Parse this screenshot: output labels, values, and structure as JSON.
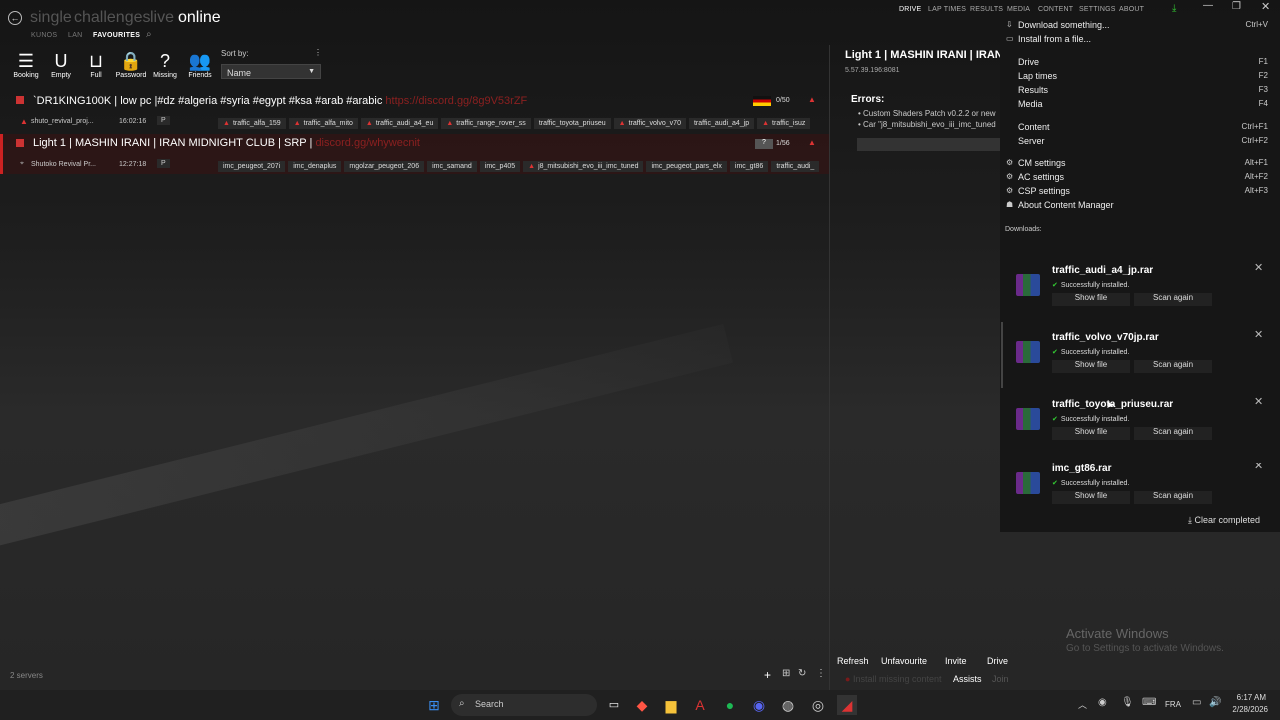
{
  "header": {
    "modes": [
      "single",
      "challenges",
      "live",
      "online"
    ],
    "submodes": [
      "KUNOS",
      "LAN",
      "FAVOURITES"
    ],
    "nav": [
      "DRIVE",
      "LAP TIMES",
      "RESULTS",
      "MEDIA",
      "CONTENT",
      "SETTINGS",
      "ABOUT"
    ]
  },
  "filters": [
    {
      "icon": "☰",
      "label": "Booking"
    },
    {
      "icon": "U",
      "label": "Empty"
    },
    {
      "icon": "⊔",
      "label": "Full"
    },
    {
      "icon": "🔒",
      "label": "Password"
    },
    {
      "icon": "?",
      "label": "Missing"
    },
    {
      "icon": "👥",
      "label": "Friends"
    }
  ],
  "sort": {
    "label": "Sort by:",
    "value": "Name"
  },
  "servers": [
    {
      "name": "`DR1KING100K | low pc |#dz #algeria #syria #egypt #ksa #arab #arabic",
      "link": "https://discord.gg/8g9V53rZF",
      "track": "shuto_revival_proj...",
      "time": "16:02:16",
      "badge": "P",
      "players": "0/50",
      "cars": [
        {
          "name": "traffic_alfa_159",
          "warn": true
        },
        {
          "name": "traffic_alfa_mito",
          "warn": true
        },
        {
          "name": "traffic_audi_a4_eu",
          "warn": true
        },
        {
          "name": "traffic_range_rover_ss",
          "warn": true
        },
        {
          "name": "traffic_toyota_priuseu",
          "warn": false
        },
        {
          "name": "traffic_volvo_v70",
          "warn": true
        },
        {
          "name": "traffic_audi_a4_jp",
          "warn": false
        },
        {
          "name": "traffic_isuz",
          "warn": true
        }
      ]
    },
    {
      "name": "Light 1 | MASHIN IRANI | IRAN MIDNIGHT CLUB | SRP |",
      "link": "discord.gg/whywecnit",
      "track": "Shutoko Revival Pr...",
      "time": "12:27:18",
      "badge": "P",
      "players": "1/56",
      "cars": [
        {
          "name": "imc_peugeot_207i",
          "warn": false
        },
        {
          "name": "imc_denaplus",
          "warn": false
        },
        {
          "name": "mgolzar_peugeot_206",
          "warn": false
        },
        {
          "name": "imc_samand",
          "warn": false
        },
        {
          "name": "imc_p405",
          "warn": false
        },
        {
          "name": "j8_mitsubishi_evo_iii_imc_tuned",
          "warn": true
        },
        {
          "name": "imc_peugeot_pars_elx",
          "warn": false
        },
        {
          "name": "imc_gt86",
          "warn": false
        },
        {
          "name": "traffic_audi_",
          "warn": false
        }
      ]
    }
  ],
  "server_count": "2 servers",
  "detail": {
    "title": "Light 1 | MASHIN IRANI | IRAN",
    "address": "5.57.39.196:8081",
    "errors_title": "Errors:",
    "errors": [
      "Custom Shaders Patch v0.2.2 or new",
      "Car \"j8_mitsubishi_evo_iii_imc_tuned"
    ]
  },
  "bottom_actions": [
    "Refresh",
    "Unfavourite",
    "Invite",
    "Drive"
  ],
  "bottom_actions2": [
    "Install missing content",
    "Assists",
    "Join"
  ],
  "menu": {
    "groups": [
      [
        {
          "label": "Download something...",
          "shortcut": "Ctrl+V",
          "icon": "⇩"
        },
        {
          "label": "Install from a file...",
          "shortcut": "",
          "icon": "▭"
        }
      ],
      [
        {
          "label": "Drive",
          "shortcut": "F1",
          "icon": ""
        },
        {
          "label": "Lap times",
          "shortcut": "F2",
          "icon": ""
        },
        {
          "label": "Results",
          "shortcut": "F3",
          "icon": ""
        },
        {
          "label": "Media",
          "shortcut": "F4",
          "icon": ""
        }
      ],
      [
        {
          "label": "Content",
          "shortcut": "Ctrl+F1",
          "icon": ""
        },
        {
          "label": "Server",
          "shortcut": "Ctrl+F2",
          "icon": ""
        }
      ],
      [
        {
          "label": "CM settings",
          "shortcut": "Alt+F1",
          "icon": "⚙"
        },
        {
          "label": "AC settings",
          "shortcut": "Alt+F2",
          "icon": "⚙"
        },
        {
          "label": "CSP settings",
          "shortcut": "Alt+F3",
          "icon": "⚙"
        },
        {
          "label": "About Content Manager",
          "shortcut": "",
          "icon": "☗"
        }
      ]
    ],
    "downloads_label": "Downloads:",
    "downloads": [
      {
        "file": "traffic_audi_a4_jp.rar",
        "status": "Successfully installed."
      },
      {
        "file": "traffic_volvo_v70jp.rar",
        "status": "Successfully installed."
      },
      {
        "file": "traffic_toyota_priuseu.rar",
        "status": "Successfully installed."
      },
      {
        "file": "imc_gt86.rar",
        "status": "Successfully installed."
      }
    ],
    "show_file": "Show file",
    "scan_again": "Scan again",
    "clear_completed": "Clear completed"
  },
  "watermark": {
    "title": "Activate Windows",
    "sub": "Go to Settings to activate Windows."
  },
  "taskbar": {
    "search": "Search",
    "lang": "FRA",
    "time": "6:17 AM",
    "date": "2/28/2026"
  }
}
